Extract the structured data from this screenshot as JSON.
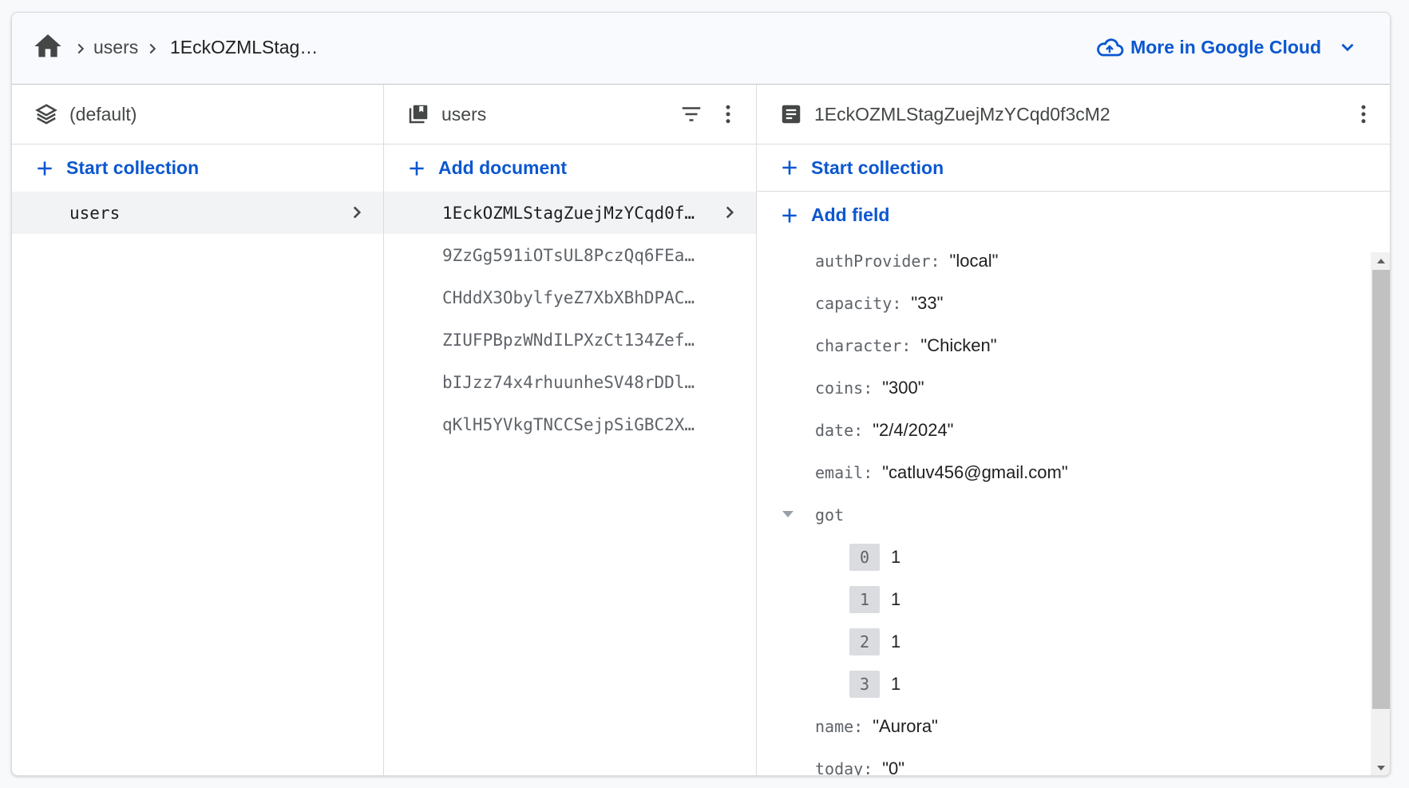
{
  "breadcrumb": {
    "items": [
      "users",
      "1EckOZMLStag…"
    ]
  },
  "cloud_link": {
    "label": "More in Google Cloud"
  },
  "columns": {
    "database": {
      "title": "(default)",
      "action_label": "Start collection",
      "items": [
        {
          "label": "users",
          "selected": true
        }
      ]
    },
    "collection": {
      "title": "users",
      "action_label": "Add document",
      "items": [
        {
          "label": "1EckOZMLStagZuejMzYCqd0f…",
          "selected": true
        },
        {
          "label": "9ZzGg591iOTsUL8PczQq6FEa…"
        },
        {
          "label": "CHddX3ObylfyeZ7XbXBhDPAC…"
        },
        {
          "label": "ZIUFPBpzWNdILPXzCt134Zef…"
        },
        {
          "label": "bIJzz74x4rhuunheSV48rDDl…"
        },
        {
          "label": "qKlH5YVkgTNCCSejpSiGBC2X…"
        }
      ]
    },
    "document": {
      "title": "1EckOZMLStagZuejMzYCqd0f3cM2",
      "start_collection_label": "Start collection",
      "add_field_label": "Add field",
      "fields_before": [
        {
          "key": "authProvider:",
          "value": "\"local\""
        },
        {
          "key": "capacity:",
          "value": "\"33\""
        },
        {
          "key": "character:",
          "value": "\"Chicken\""
        },
        {
          "key": "coins:",
          "value": "\"300\""
        },
        {
          "key": "date:",
          "value": "\"2/4/2024\""
        },
        {
          "key": "email:",
          "value": "\"catluv456@gmail.com\""
        }
      ],
      "array_field": {
        "key": "got",
        "items": [
          {
            "index": "0",
            "value": "1"
          },
          {
            "index": "1",
            "value": "1"
          },
          {
            "index": "2",
            "value": "1"
          },
          {
            "index": "3",
            "value": "1"
          }
        ]
      },
      "fields_after": [
        {
          "key": "name:",
          "value": "\"Aurora\""
        },
        {
          "key": "today:",
          "value": "\"0\""
        }
      ]
    }
  },
  "colors": {
    "accent": "#0b57d0",
    "text": "#444746",
    "header_bg": "#f8fafd"
  }
}
